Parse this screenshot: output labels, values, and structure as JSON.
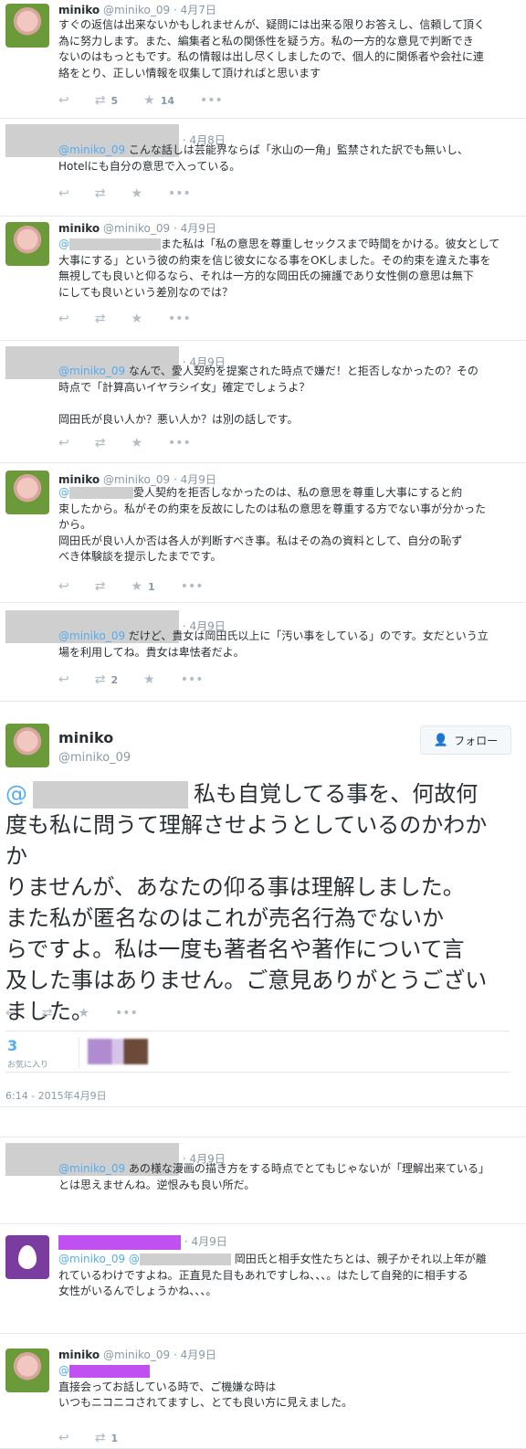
{
  "tweets": [
    {
      "name": "miniko",
      "handle": "@miniko_09",
      "date": "4月7日",
      "lines": [
        "すぐの返信は出来ないかもしれませんが、疑問には出来る限りお答えし、信頼して頂く",
        "為に努力します。また、編集者と私の関係性を疑う方。私の一方的な意見で判断でき",
        "ないのはもっともです。私の情報は出し尽くしましたので、個人的に関係者や会社に連",
        "絡をとり、正しい情報を収集して頂ければと思います"
      ],
      "retweets": "5",
      "favorites": "14"
    },
    {
      "date": "4月8日",
      "mention": "@miniko_09",
      "lines": [
        " こんな話しは芸能界ならば「氷山の一角」監禁された訳でも無いし、",
        "Hotelにも自分の意思で入っている。"
      ]
    },
    {
      "name": "miniko",
      "handle": "@miniko_09",
      "date": "4月9日",
      "mention": "@",
      "lines": [
        "また私は「私の意思を尊重しセックスまで時間をかける。彼女として",
        "大事にする」という彼の約束を信じ彼女になる事をOKしました。その約束を違えた事を",
        "無視しても良いと仰るなら、それは一方的な岡田氏の擁護であり女性側の意思は無下",
        "にしても良いという差別なのでは？"
      ]
    },
    {
      "date": "4月9日",
      "mention": "@miniko_09",
      "lines": [
        " なんで、愛人契約を提案された時点で嫌だ！と拒否しなかったの？その",
        "時点で「計算高いイヤラシイ女」確定でしょうよ？",
        "",
        "岡田氏が良い人か？悪い人か？は別の話しです。"
      ]
    },
    {
      "name": "miniko",
      "handle": "@miniko_09",
      "date": "4月9日",
      "lines": [
        "愛人契約を拒否しなかったのは、私の意思を尊重し大事にすると約",
        "束したから。私がその約束を反故にしたのは私の意思を尊重する方でない事が分かった",
        "から。",
        "岡田氏が良い人か否は各人が判断すべき事。私はその為の資料として、自分の恥ず",
        "べき体験談を提示したまでです。"
      ],
      "favorites": "1"
    },
    {
      "date": "4月9日",
      "mention": "@miniko_09",
      "lines": [
        " だけど、貴女は岡田氏以上に「汚い事をしている」のです。女だという立",
        "場を利用してね。貴女は卑怯者だよ。"
      ],
      "retweets": "2"
    }
  ],
  "main_tweet": {
    "name": "miniko",
    "handle": "@miniko_09",
    "follow_label": "フォロー",
    "mention": "@",
    "lines": [
      "私も自覚してる事を、何故何",
      "度も私に問うて理解させようとしているのかわかか",
      "りませんが、あなたの仰る事は理解しました。",
      "また私が匿名なのはこれが売名行為でないか",
      "らですよ。私は一度も著者名や著作について言",
      "及した事はありません。ご意見ありがとうござい",
      "ました。"
    ],
    "favorites_count": "3",
    "favorites_label": "お気に入り",
    "timestamp": "6:14 - 2015年4月9日"
  },
  "replies": [
    {
      "date": "4月9日",
      "mention": "@miniko_09",
      "lines": [
        " あの様な漫画の描き方をする時点でとてもじゃないが「理解出来ている」",
        "とは思えませんね。逆恨みも良い所だ。"
      ]
    },
    {
      "date": "4月9日",
      "mention": "@miniko_09 @",
      "lines": [
        " 岡田氏と相手女性たちとは、親子かそれ以上年が離",
        "れているわけですよね。正直見た目もあれですしね、、、。はたして自発的に相手する",
        "女性がいるんでしょうかね、、、。"
      ]
    },
    {
      "name": "miniko",
      "handle": "@miniko_09",
      "date": "4月9日",
      "mention": "@",
      "lines": [
        "直接会ってお話している時で、ご機嫌な時は",
        "いつもニコニコされてますし、とても良い方に見えました。"
      ],
      "retweets": "1"
    }
  ],
  "icons": {
    "reply": "reply-icon",
    "retweet": "retweet-icon",
    "favorite": "star-icon",
    "follow": "add-user-icon",
    "default_avatar": "egg-avatar"
  },
  "colors": {
    "link": "#55acee",
    "redaction_gray": "#cfcfcf",
    "redaction_purple": "#c050f0"
  }
}
